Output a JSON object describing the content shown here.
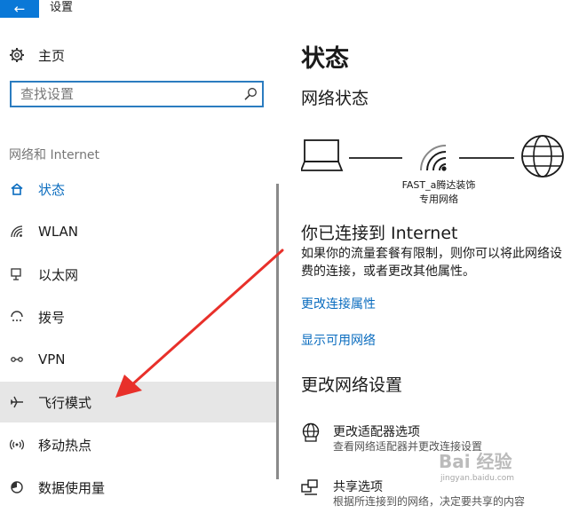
{
  "window": {
    "back_icon": "←",
    "title": "设置"
  },
  "sidebar": {
    "home_label": "主页",
    "search": {
      "placeholder": "查找设置",
      "value": ""
    },
    "section_title": "网络和 Internet",
    "items": [
      {
        "label": "状态",
        "icon": "home-status-icon",
        "active": true
      },
      {
        "label": "WLAN",
        "icon": "wifi-icon"
      },
      {
        "label": "以太网",
        "icon": "ethernet-icon"
      },
      {
        "label": "拨号",
        "icon": "dialup-icon"
      },
      {
        "label": "VPN",
        "icon": "vpn-icon"
      },
      {
        "label": "飞行模式",
        "icon": "airplane-icon",
        "selected": true
      },
      {
        "label": "移动热点",
        "icon": "hotspot-icon"
      },
      {
        "label": "数据使用量",
        "icon": "data-usage-icon"
      }
    ]
  },
  "main": {
    "title": "状态",
    "network_status_heading": "网络状态",
    "network_name_line1": "FAST_a腾达装饰",
    "network_name_line2": "专用网络",
    "connected_heading": "你已连接到 Internet",
    "connected_desc_line1": "如果你的流量套餐有限制，则你可以将此网络设",
    "connected_desc_line2": "费的连接，或者更改其他属性。",
    "link_change_props": "更改连接属性",
    "link_show_networks": "显示可用网络",
    "change_settings_heading": "更改网络设置",
    "options": [
      {
        "title": "更改适配器选项",
        "desc": "查看网络适配器并更改连接设置",
        "icon": "adapter-globe-icon"
      },
      {
        "title": "共享选项",
        "desc": "根据所连接到的网络，决定要共享的内容",
        "icon": "sharing-icon"
      }
    ]
  },
  "watermark": {
    "logo": "Bai 经验",
    "url": "jingyan.baidu.com"
  },
  "colors": {
    "accent": "#0a78d7",
    "link": "#0a6cbf",
    "selected_bg": "#e6e6e6",
    "annotation": "#e8302a"
  }
}
